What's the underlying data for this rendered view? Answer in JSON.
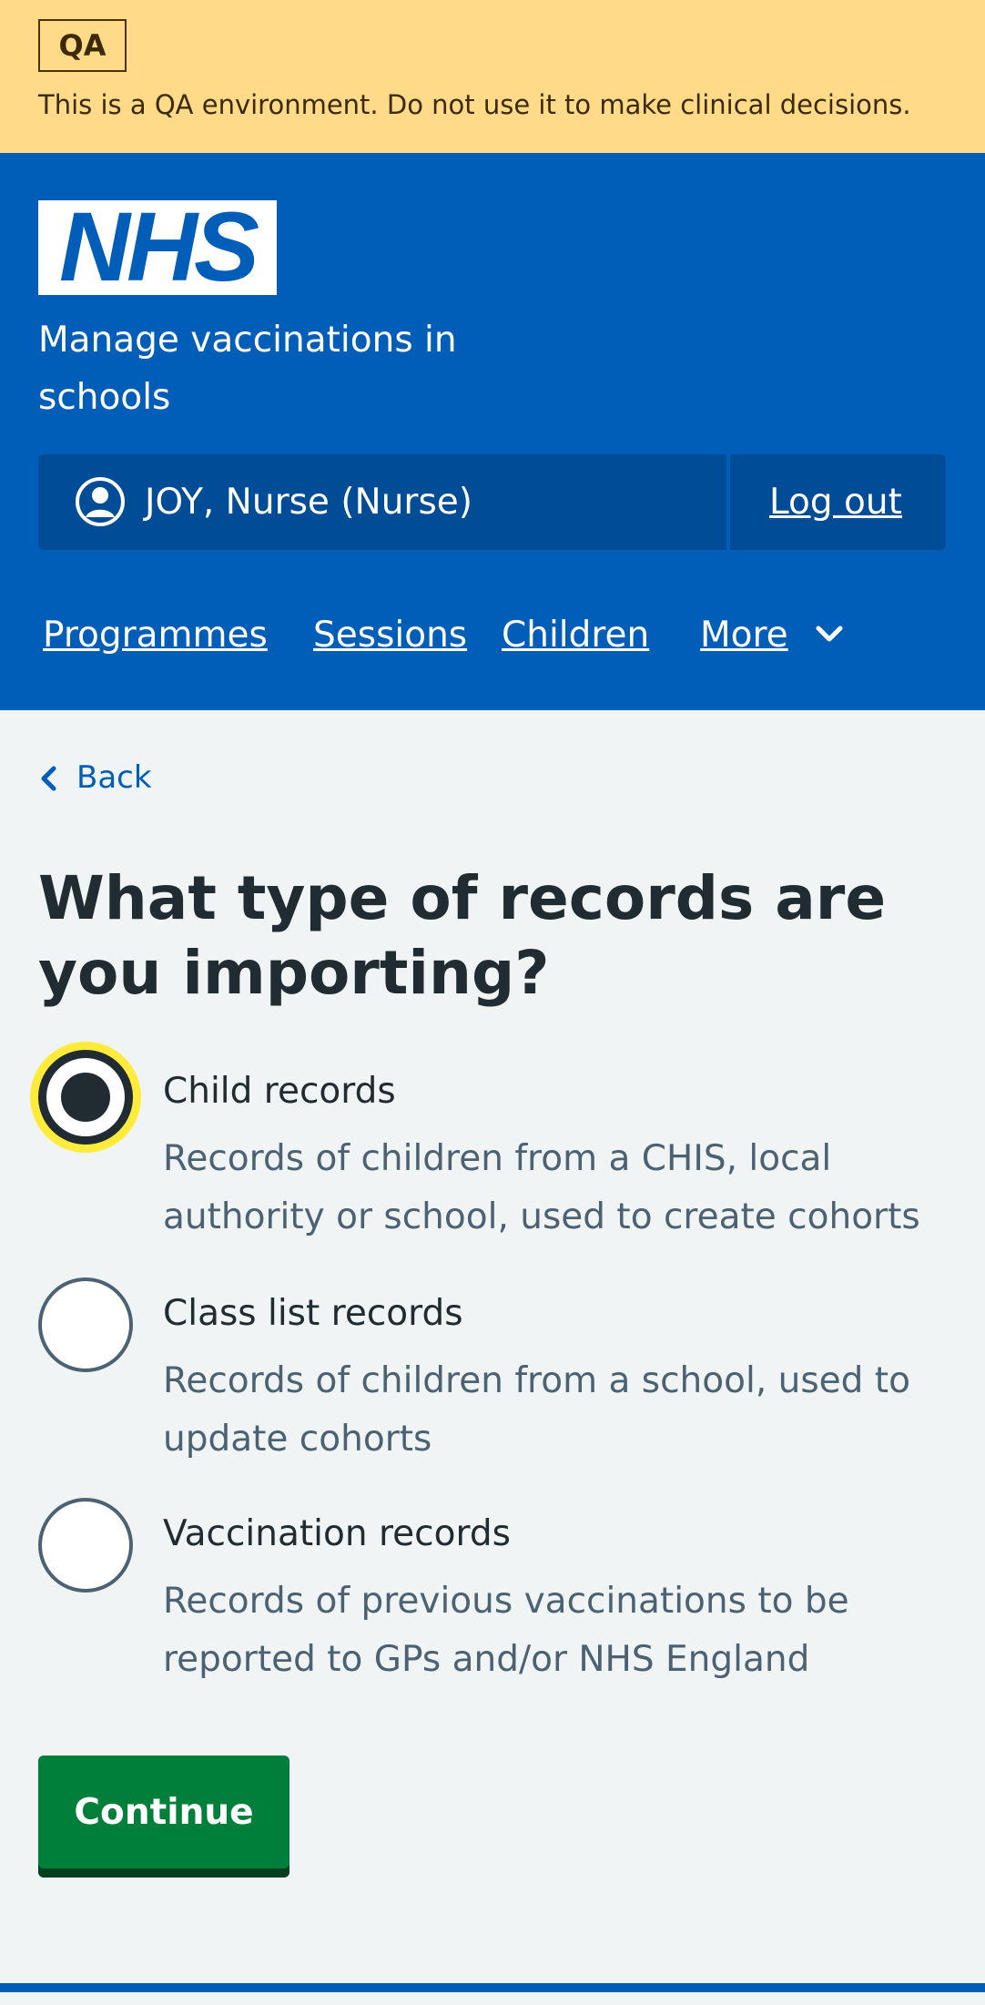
{
  "qa_banner": {
    "tag": "QA",
    "message": "This is a QA environment. Do not use it to make clinical decisions."
  },
  "header": {
    "logo_text": "NHS",
    "service_name": "Manage vaccinations in schools",
    "account": {
      "user": "JOY, Nurse (Nurse)",
      "logout": "Log out"
    },
    "nav": [
      "Programmes",
      "Sessions",
      "Children",
      "More"
    ]
  },
  "back_link": "Back",
  "page_title": "What type of records are you importing?",
  "options": [
    {
      "label": "Child records",
      "hint": "Records of children from a CHIS, local authority or school, used to create cohorts",
      "checked": true
    },
    {
      "label": "Class list records",
      "hint": "Records of children from a school, used to update cohorts",
      "checked": false
    },
    {
      "label": "Vaccination records",
      "hint": "Records of previous vaccinations to be reported to GPs and/or NHS England",
      "checked": false
    }
  ],
  "continue_button": "Continue",
  "colors": {
    "nhs_blue": "#005eb8",
    "qa_banner": "#ffda88",
    "button_green": "#007f3b",
    "focus_yellow": "#ffeb3b"
  }
}
